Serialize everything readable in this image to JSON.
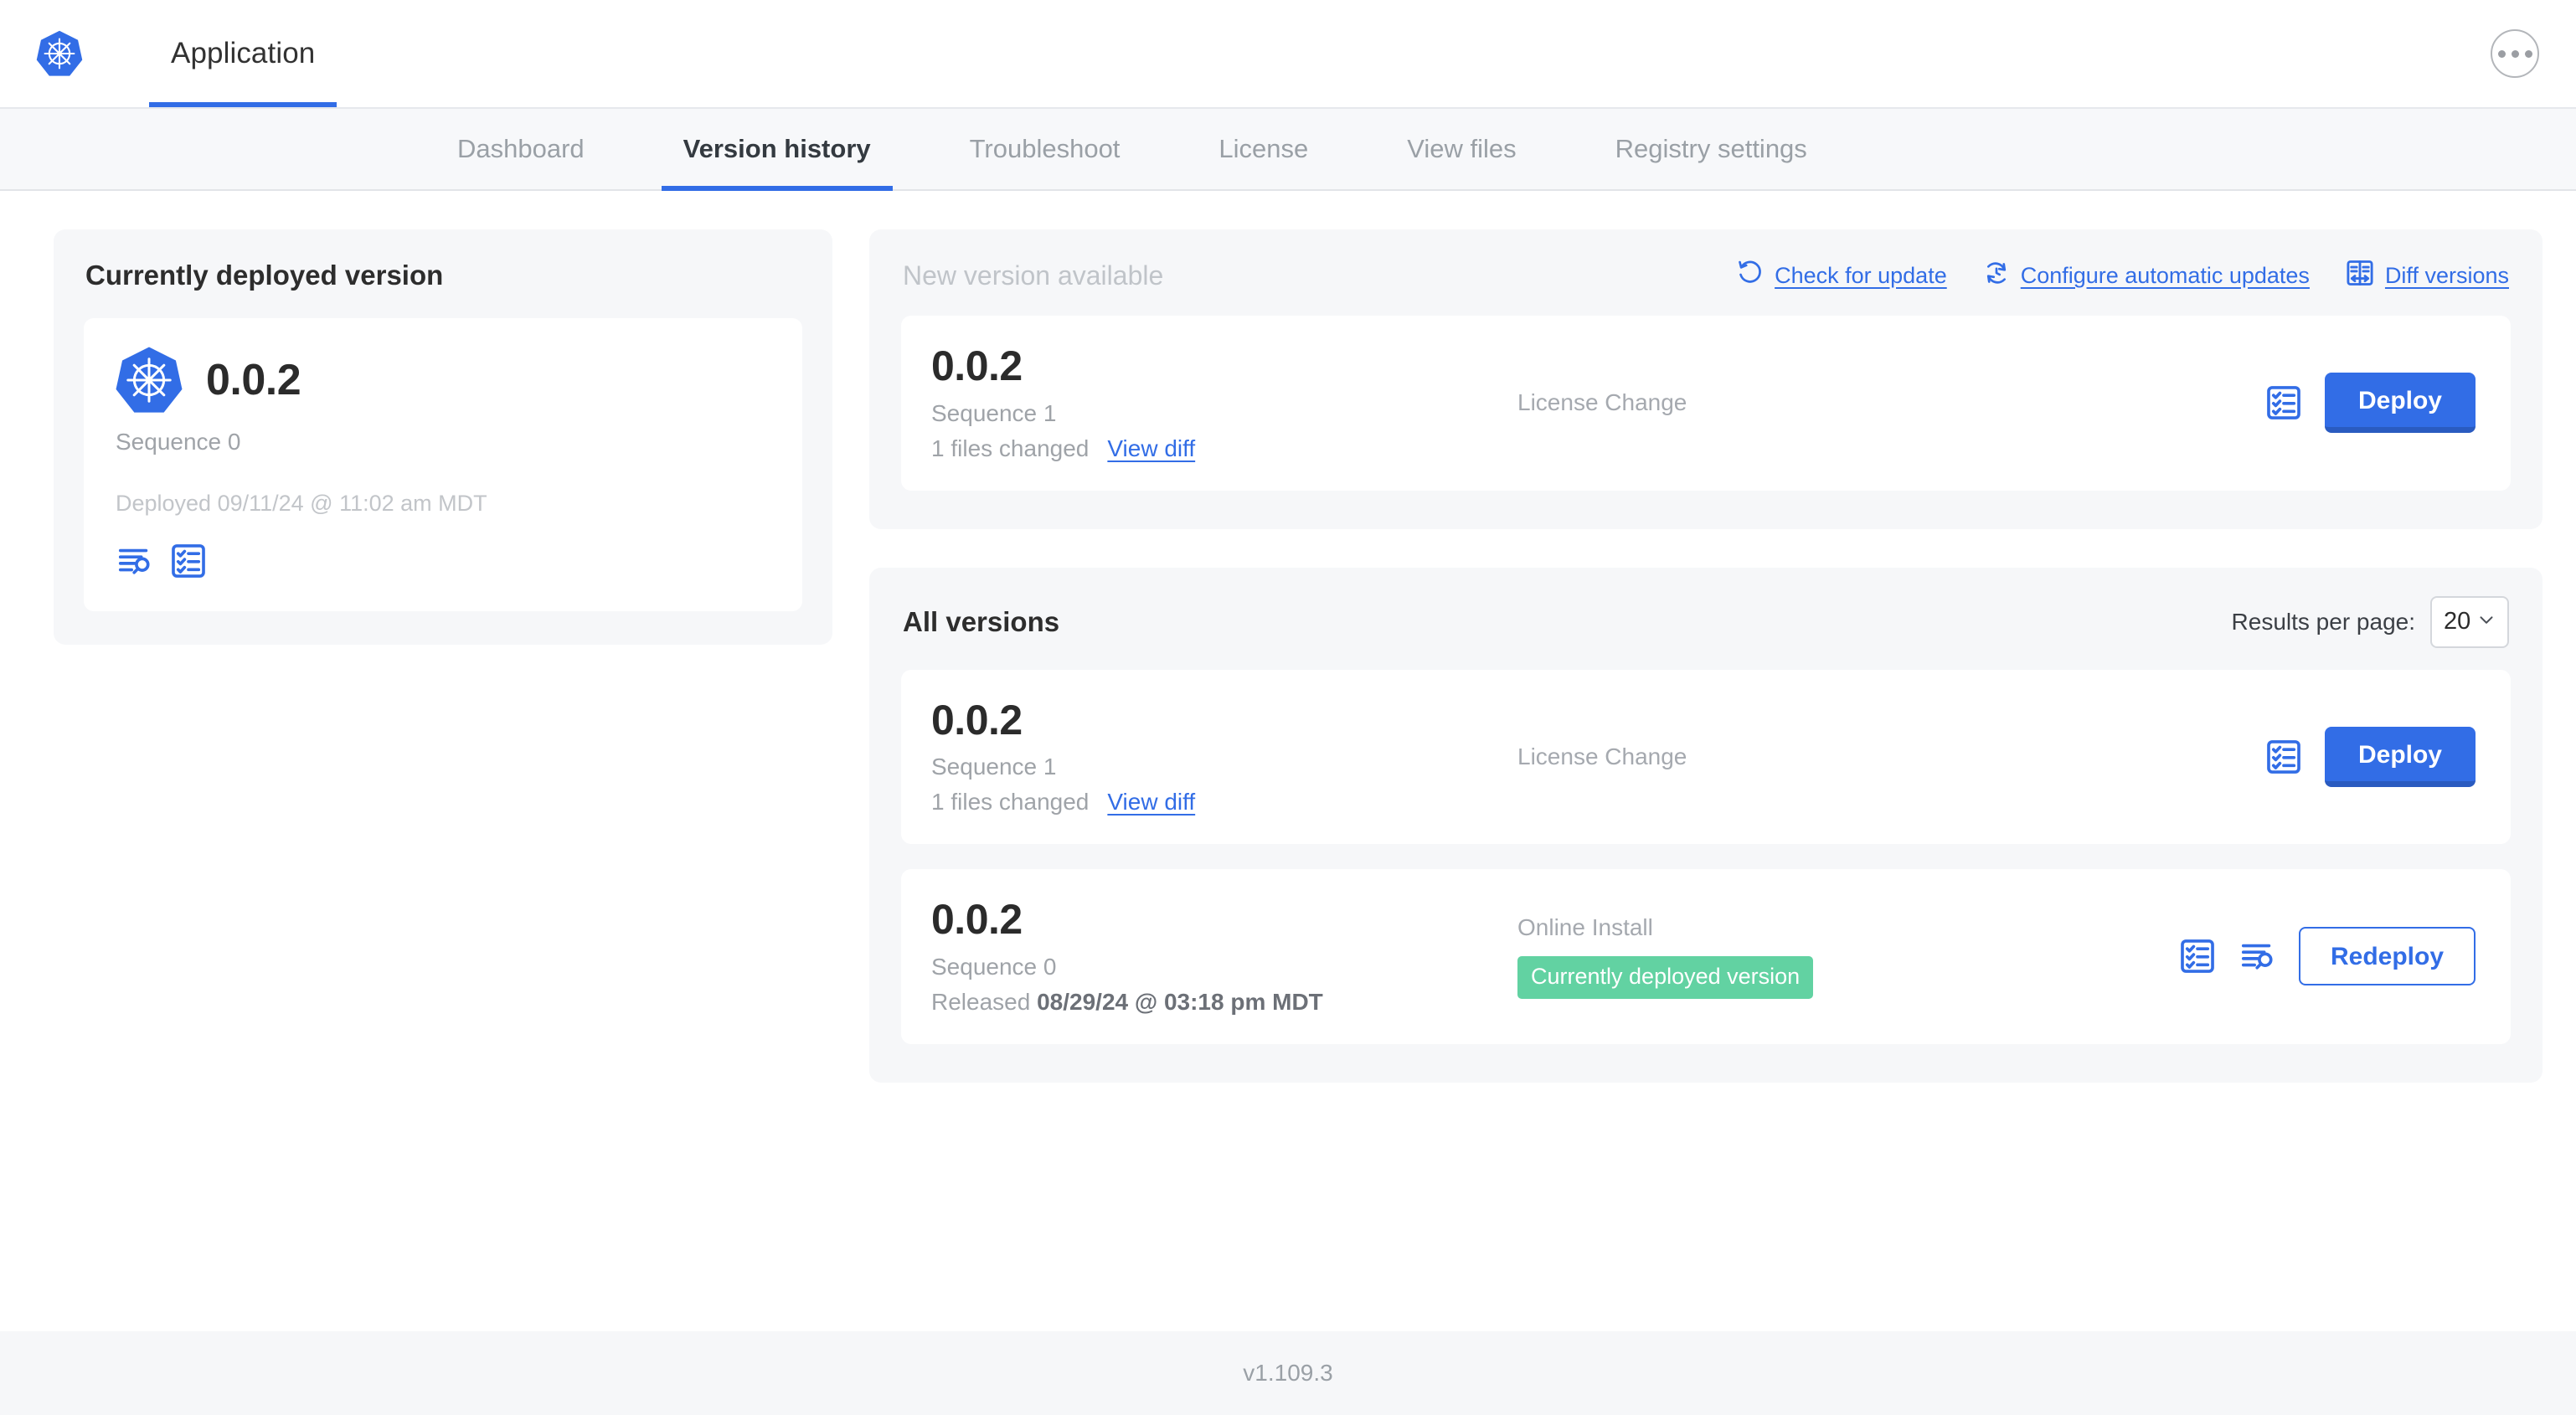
{
  "header": {
    "logo_icon": "kubernetes-logo",
    "app_title": "Application",
    "menu_icon": "ellipsis-icon"
  },
  "nav": {
    "tabs": [
      {
        "label": "Dashboard",
        "active": false
      },
      {
        "label": "Version history",
        "active": true
      },
      {
        "label": "Troubleshoot",
        "active": false
      },
      {
        "label": "License",
        "active": false
      },
      {
        "label": "View files",
        "active": false
      },
      {
        "label": "Registry settings",
        "active": false
      }
    ]
  },
  "deployed_panel": {
    "title": "Currently deployed version",
    "version": "0.0.2",
    "sequence": "Sequence 0",
    "deployed_at": "Deployed 09/11/24 @ 11:02 am MDT",
    "icons": [
      "log-search-icon",
      "preflight-checks-icon"
    ]
  },
  "new_version_panel": {
    "title": "New version available",
    "actions": [
      {
        "label": "Check for update",
        "icon": "rotate-ccw-icon"
      },
      {
        "label": "Configure automatic updates",
        "icon": "clock-rotate-icon"
      },
      {
        "label": "Diff versions",
        "icon": "diff-versions-icon"
      }
    ],
    "card": {
      "version": "0.0.2",
      "sequence": "Sequence 1",
      "files_changed": "1 files changed",
      "view_diff_label": "View diff",
      "type": "License Change",
      "icon": "preflight-checks-icon",
      "button_label": "Deploy"
    }
  },
  "all_versions_panel": {
    "title": "All versions",
    "results_per_page_label": "Results per page:",
    "results_per_page_value": "20",
    "chevron_icon": "chevron-down-icon",
    "rows": [
      {
        "version": "0.0.2",
        "sequence": "Sequence 1",
        "files_changed": "1 files changed",
        "view_diff_label": "View diff",
        "type": "License Change",
        "badge": "",
        "icons": [
          "preflight-checks-icon"
        ],
        "button_label": "Deploy",
        "button_style": "primary"
      },
      {
        "version": "0.0.2",
        "sequence": "Sequence 0",
        "released_prefix": "Released ",
        "released_date": "08/29/24 @ 03:18 pm MDT",
        "type": "Online Install",
        "badge": "Currently deployed version",
        "icons": [
          "preflight-checks-icon",
          "log-search-icon"
        ],
        "button_label": "Redeploy",
        "button_style": "outline"
      }
    ]
  },
  "footer": {
    "version": "v1.109.3"
  },
  "colors": {
    "accent_blue": "#326de6",
    "badge_green": "#62d2a2",
    "panel_gray": "#f6f7f9",
    "muted_text": "#9fa3a8"
  }
}
